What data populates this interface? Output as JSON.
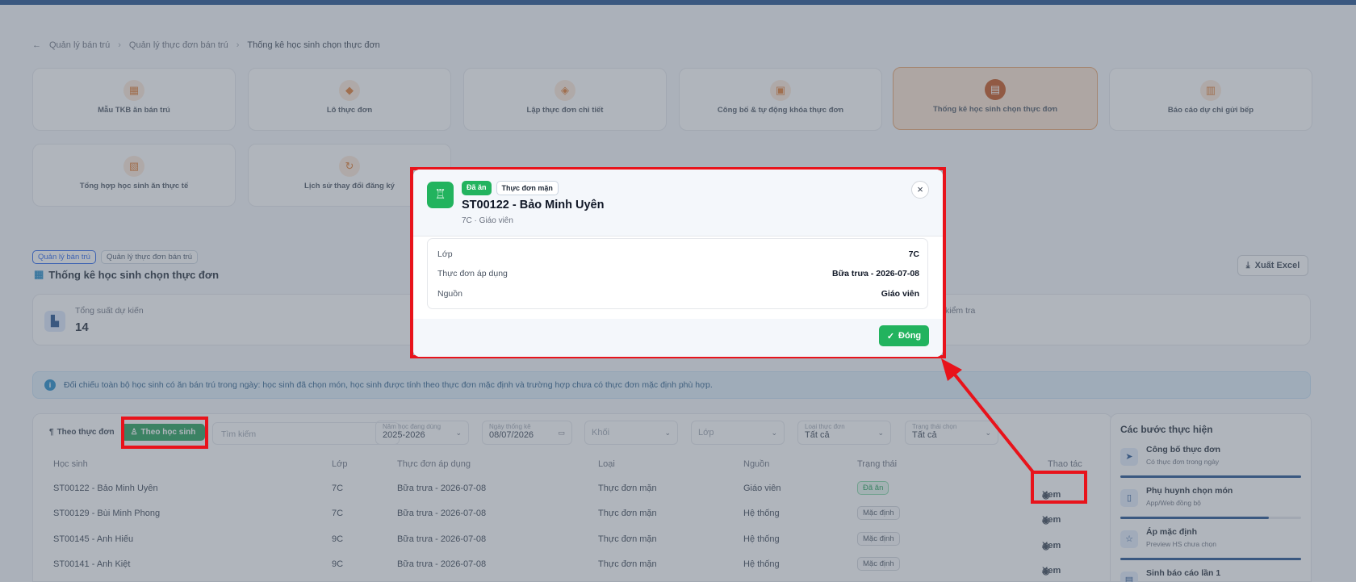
{
  "breadcrumb": {
    "back_icon": "arrow-left-icon",
    "items": [
      "Quản lý bán trú",
      "Quản lý thực đơn bán trú",
      "Thống kê học sinh chọn thực đơn"
    ]
  },
  "modules": [
    {
      "label": "Mẫu TKB ăn bán trú",
      "icon": "calendar-icon"
    },
    {
      "label": "Lô thực đơn",
      "icon": "box-icon"
    },
    {
      "label": "Lập thực đơn chi tiết",
      "icon": "layers-icon"
    },
    {
      "label": "Công bố & tự động khóa thực đơn",
      "icon": "lock-icon"
    },
    {
      "label": "Thống kê học sinh chọn thực đơn",
      "icon": "chart-icon",
      "active": true
    },
    {
      "label": "Báo cáo dự chi gửi bếp",
      "icon": "report-icon"
    },
    {
      "label": "Tổng hợp học sinh ăn thực tế",
      "icon": "summary-icon"
    },
    {
      "label": "Lịch sử thay đổi đăng ký",
      "icon": "history-icon"
    }
  ],
  "section": {
    "tags": [
      "Quản lý bán trú",
      "Quản lý thực đơn bán trú"
    ],
    "title": "Thống kê học sinh chọn thực đơn",
    "export_label": "Xuất Excel"
  },
  "stats": {
    "label": "Tổng suất dự kiến",
    "value": "14",
    "label2": "kiểm tra"
  },
  "info_text": "Đối chiếu toàn bộ học sinh có ăn bán trú trong ngày: học sinh đã chọn món, học sinh được tính theo thực đơn mặc định và trường hợp chưa có thực đơn mặc định phù hợp.",
  "filters": {
    "toggle_menu": "Theo thực đơn",
    "toggle_student": "Theo học sinh",
    "search_placeholder": "Tìm kiếm",
    "school_year_label": "Năm học đang dùng",
    "school_year_value": "2025-2026",
    "date_label": "Ngày thống kê",
    "date_value": "08/07/2026",
    "grade_placeholder": "Khối",
    "class_placeholder": "Lớp",
    "menu_type_label": "Loại thực đơn",
    "menu_type_value": "Tất cả",
    "status_label": "Trạng thái chọn",
    "status_value": "Tất cả"
  },
  "table": {
    "columns": [
      "Học sinh",
      "Lớp",
      "Thực đơn áp dụng",
      "Loại",
      "Nguồn",
      "Trạng thái",
      "Thao tác"
    ],
    "view_label": "Xem",
    "rows": [
      {
        "student": "ST00122 - Bảo Minh Uyên",
        "class": "7C",
        "menu": "Bữa trưa - 2026-07-08",
        "type": "Thực đơn mặn",
        "source": "Giáo viên",
        "status": "Đã ăn",
        "status_kind": "green"
      },
      {
        "student": "ST00129 - Bùi Minh Phong",
        "class": "7C",
        "menu": "Bữa trưa - 2026-07-08",
        "type": "Thực đơn mặn",
        "source": "Hệ thống",
        "status": "Mặc định",
        "status_kind": "gray"
      },
      {
        "student": "ST00145 - Anh Hiếu",
        "class": "9C",
        "menu": "Bữa trưa - 2026-07-08",
        "type": "Thực đơn mặn",
        "source": "Hệ thống",
        "status": "Mặc định",
        "status_kind": "gray"
      },
      {
        "student": "ST00141 - Anh Kiệt",
        "class": "9C",
        "menu": "Bữa trưa - 2026-07-08",
        "type": "Thực đơn mặn",
        "source": "Hệ thống",
        "status": "Mặc định",
        "status_kind": "gray"
      }
    ]
  },
  "steps": {
    "title": "Các bước thực hiện",
    "items": [
      {
        "title": "Công bố thực đơn",
        "sub": "Có thực đơn trong ngày",
        "progress": 1.0,
        "icon": "send-icon"
      },
      {
        "title": "Phụ huynh chọn món",
        "sub": "App/Web đồng bộ",
        "progress": 0.82,
        "icon": "phone-icon"
      },
      {
        "title": "Áp mặc định",
        "sub": "Preview HS chưa chọn",
        "progress": 1.0,
        "icon": "star-icon"
      },
      {
        "title": "Sinh báo cáo lần 1",
        "sub": "",
        "progress": 0,
        "icon": "file-icon"
      }
    ]
  },
  "modal": {
    "icon": "chef-icon",
    "badge_status": "Đã ăn",
    "badge_type": "Thực đơn mặn",
    "title": "ST00122 - Bảo Minh Uyên",
    "subtitle": "7C · Giáo viên",
    "fields": [
      {
        "key": "Lớp",
        "value": "7C"
      },
      {
        "key": "Thực đơn áp dụng",
        "value": "Bữa trưa - 2026-07-08"
      },
      {
        "key": "Nguồn",
        "value": "Giáo viên"
      }
    ],
    "close_label": "Đóng",
    "colors": {
      "accent": "#22b35e",
      "highlight": "#e8131b"
    }
  }
}
